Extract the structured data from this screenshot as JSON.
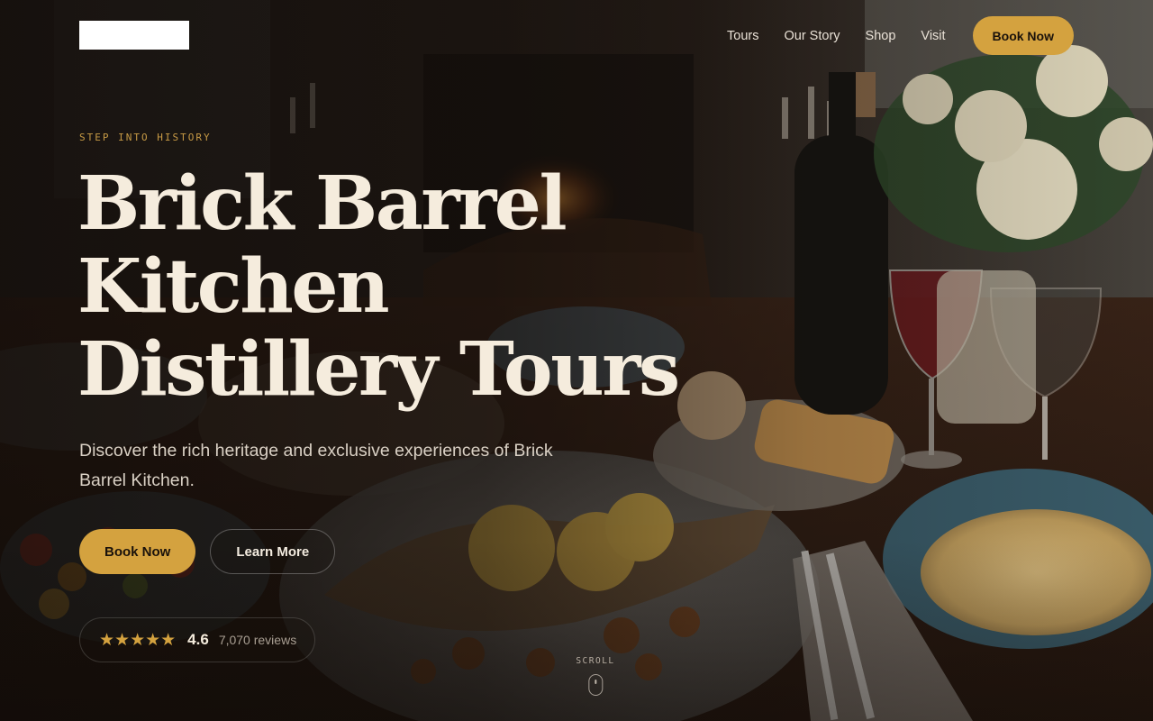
{
  "header": {
    "nav": [
      {
        "label": "Tours"
      },
      {
        "label": "Our Story"
      },
      {
        "label": "Shop"
      },
      {
        "label": "Visit"
      }
    ],
    "book_label": "Book Now"
  },
  "hero": {
    "eyebrow": "STEP INTO HISTORY",
    "title_lines": [
      "Brick Barrel",
      "Kitchen",
      "Distillery Tours"
    ],
    "subtitle": "Discover the rich heritage and exclusive experiences of Brick Barrel Kitchen.",
    "primary_cta": "Book Now",
    "secondary_cta": "Learn More",
    "rating": {
      "stars": "★★★★★",
      "score": "4.6",
      "reviews": "7,070 reviews"
    },
    "scroll_label": "SCROLL"
  },
  "colors": {
    "accent": "#d4a23f",
    "eyebrow": "#c79a45",
    "title": "#f5ecdd",
    "background": "#1b140f"
  },
  "icons": [
    "star-icon",
    "mouse-scroll-icon"
  ]
}
